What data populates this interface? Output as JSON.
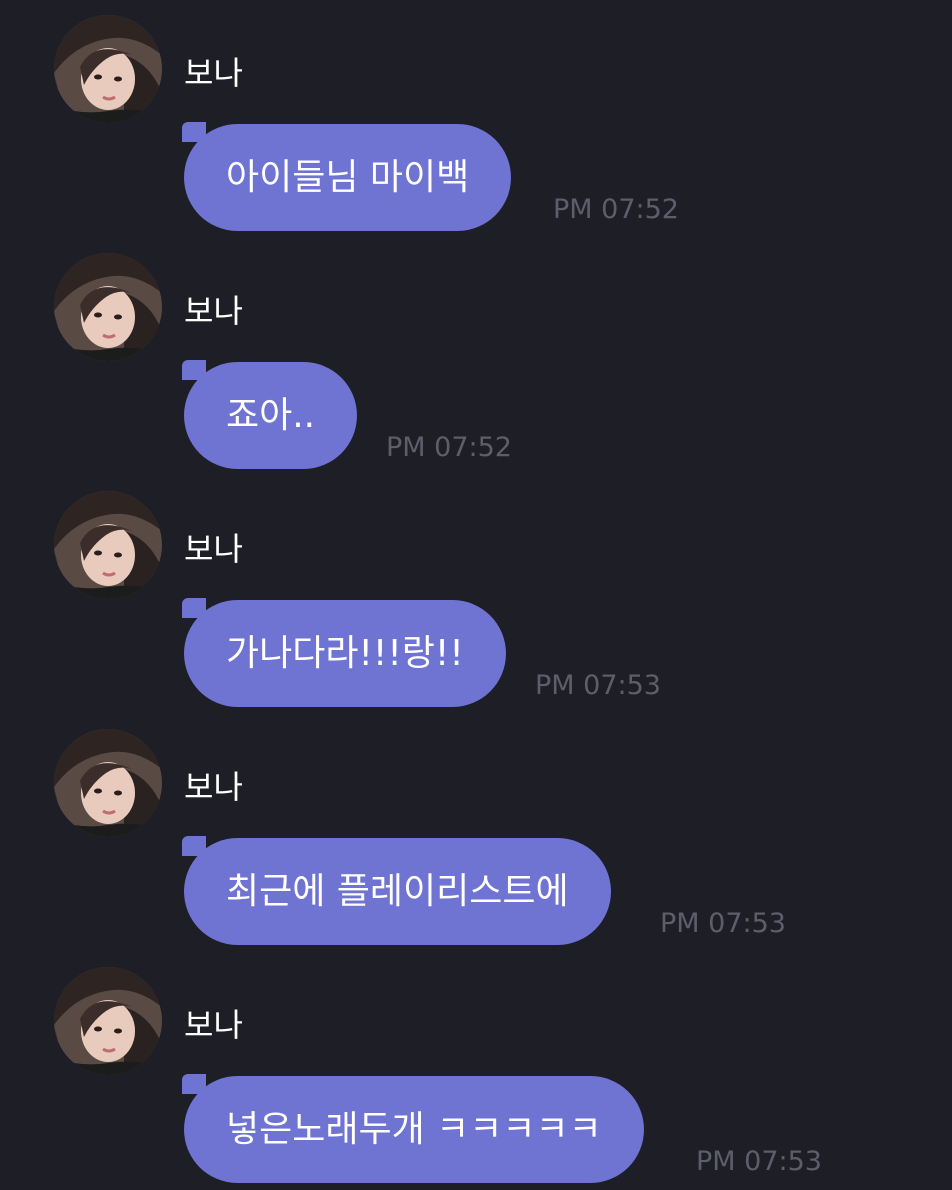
{
  "colors": {
    "background": "#1e1e26",
    "bubble": "#6f73d2",
    "sender_text": "#ffffff",
    "message_text": "#ffffff",
    "timestamp": "#5d5e6b"
  },
  "messages": [
    {
      "sender": "보나",
      "avatar_icon": "profile-photo",
      "text": "아이들님 마이백",
      "time": "PM 07:52"
    },
    {
      "sender": "보나",
      "avatar_icon": "profile-photo",
      "text": "죠아..",
      "time": "PM 07:52"
    },
    {
      "sender": "보나",
      "avatar_icon": "profile-photo",
      "text": "가나다라!!!랑!!",
      "time": "PM 07:53"
    },
    {
      "sender": "보나",
      "avatar_icon": "profile-photo",
      "text": "최근에 플레이리스트에",
      "time": "PM 07:53"
    },
    {
      "sender": "보나",
      "avatar_icon": "profile-photo",
      "text": "넣은노래두개 ㅋㅋㅋㅋㅋ",
      "time": "PM 07:53"
    }
  ]
}
